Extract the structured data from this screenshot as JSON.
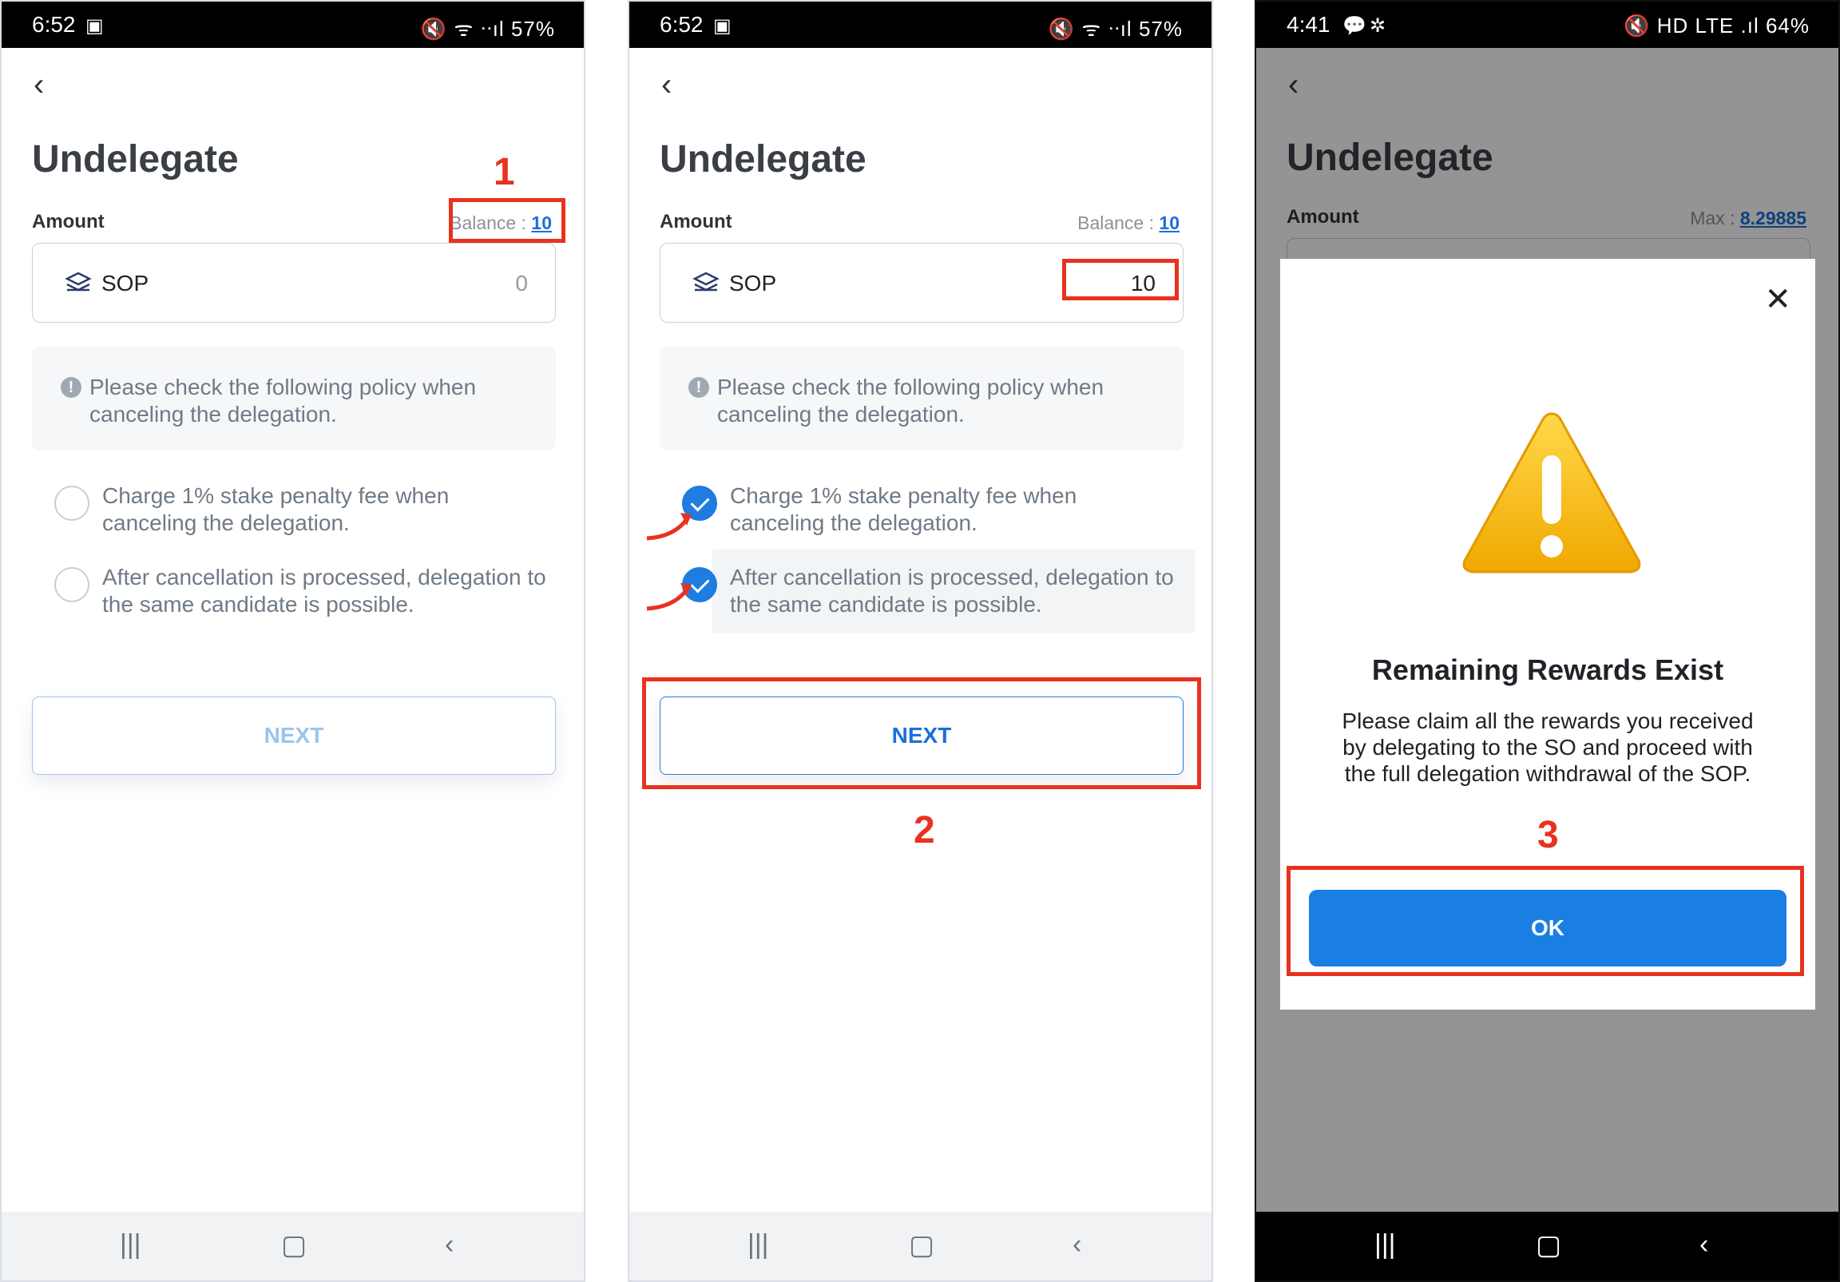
{
  "status_a": {
    "time": "6:52",
    "battery": "57%",
    "icons": "🔇 ᯤ ᐧᐧıl"
  },
  "status_b": {
    "time": "4:41",
    "battery": "64%",
    "icons": "🔇 HD LTE .ıl"
  },
  "screen": {
    "title": "Undelegate",
    "amount_label": "Amount",
    "balance_label": "Balance :",
    "balance_value": "10",
    "max_label": "Max :",
    "max_value": "8.29885",
    "token": "SOP",
    "policy_notice": "Please check the following policy when canceling the delegation.",
    "check_1": "Charge 1% stake penalty fee when canceling the delegation.",
    "check_2": "After cancellation is processed, delegation to the same candidate is possible.",
    "next_label": "NEXT"
  },
  "screen1": {
    "amount_value": "0",
    "check_1_checked": false,
    "check_2_checked": false
  },
  "screen2": {
    "amount_value": "10",
    "check_1_checked": true,
    "check_2_checked": true
  },
  "dialog": {
    "title": "Remaining Rewards Exist",
    "message": "Please claim all the rewards you received by delegating to the SO and proceed with the full delegation withdrawal of the SOP.",
    "ok_label": "OK"
  },
  "annotations": {
    "step1": "1",
    "step2": "2",
    "step3": "3",
    "color": "#e8321f"
  },
  "colors": {
    "accent": "#1a7fe3",
    "title_gray": "#3a3f45",
    "muted_text": "#6f7a86"
  },
  "icons": {
    "back": "chevron-left-icon",
    "token": "sop-token-icon",
    "info": "info-icon",
    "close": "close-icon",
    "warning": "warning-icon",
    "nav_recent": "recent-apps-icon",
    "nav_home": "home-icon",
    "nav_back": "back-nav-icon"
  }
}
